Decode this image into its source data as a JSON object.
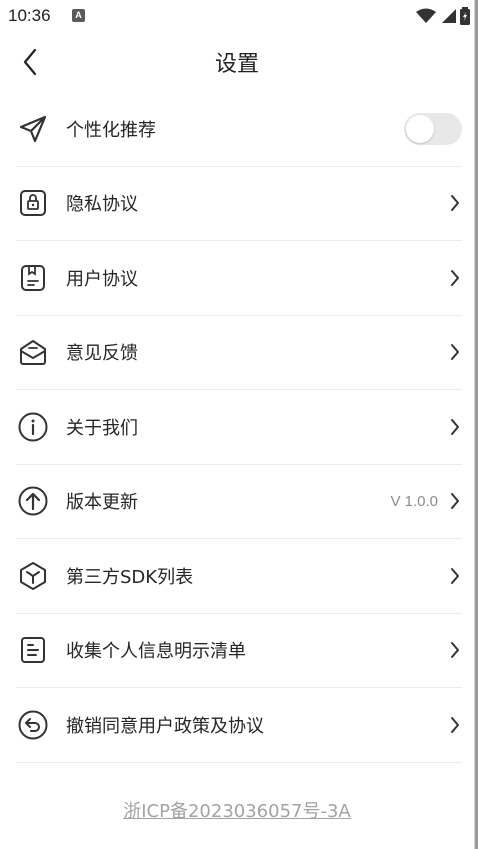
{
  "status_bar": {
    "time": "10:36",
    "notification_letter": "A"
  },
  "header": {
    "title": "设置"
  },
  "settings": [
    {
      "label": "个性化推荐",
      "icon": "send-icon",
      "control": "toggle",
      "toggle_on": false
    },
    {
      "label": "隐私协议",
      "icon": "lock-icon"
    },
    {
      "label": "用户协议",
      "icon": "document-icon"
    },
    {
      "label": "意见反馈",
      "icon": "mail-icon"
    },
    {
      "label": "关于我们",
      "icon": "info-icon"
    },
    {
      "label": "版本更新",
      "icon": "upload-icon",
      "value": "V 1.0.0"
    },
    {
      "label": "第三方SDK列表",
      "icon": "cube-icon"
    },
    {
      "label": "收集个人信息明示清单",
      "icon": "list-doc-icon"
    },
    {
      "label": "撤销同意用户政策及协议",
      "icon": "undo-icon"
    }
  ],
  "footer": {
    "icp": "浙ICP备2023036057号-3A"
  }
}
